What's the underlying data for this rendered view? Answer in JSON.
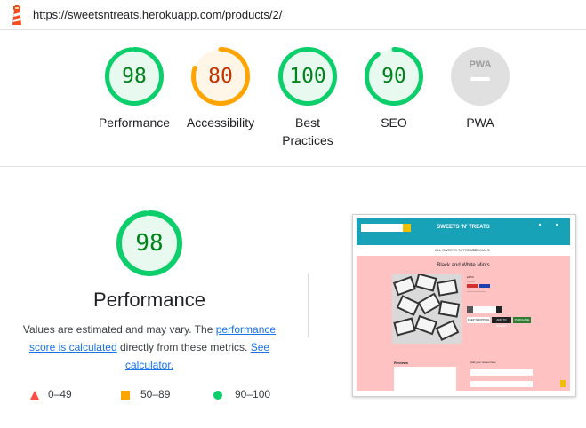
{
  "url": "https://sweetsntreats.herokuapp.com/products/2/",
  "categories": [
    {
      "label": "Performance",
      "score": 98,
      "score_text": "98",
      "color": "#0cce6b",
      "bg": "#e8f9ef",
      "text_color": "#00831b"
    },
    {
      "label": "Accessibility",
      "score": 80,
      "score_text": "80",
      "color": "#ffa400",
      "bg": "#fff6e8",
      "text_color": "#c33300"
    },
    {
      "label": "Best Practices",
      "score": 100,
      "score_text": "100",
      "color": "#0cce6b",
      "bg": "#e8f9ef",
      "text_color": "#00831b"
    },
    {
      "label": "SEO",
      "score": 90,
      "score_text": "90",
      "color": "#0cce6b",
      "bg": "#e8f9ef",
      "text_color": "#00831b"
    },
    {
      "label": "PWA",
      "score_text": "PWA",
      "color": "#e0e0e0",
      "bg": "#e0e0e0",
      "text_color": "#9e9e9e"
    }
  ],
  "performance": {
    "score": 98,
    "score_text": "98",
    "title": "Performance",
    "desc_start": "Values are estimated and may vary. The ",
    "link1": "performance score is calculated",
    "desc_mid": " directly from these metrics. ",
    "link2": "See calculator."
  },
  "legend": [
    {
      "icon": "red-triangle-icon",
      "range": "0–49",
      "color": "#ff4e42"
    },
    {
      "icon": "orange-square-icon",
      "range": "50–89",
      "color": "#ffa400"
    },
    {
      "icon": "green-circle-icon",
      "range": "90–100",
      "color": "#0cce6b"
    }
  ],
  "screenshot": {
    "brand": "SWEETS 'N' TREATS",
    "nav": [
      "ALL SWEETS 'N' TREATS",
      "SPECIALS"
    ],
    "product_title": "Black and White Mints",
    "price": "£2.50",
    "buttons": [
      "KEEP SHOPPING",
      "ADD TO BASKET",
      "PURCHASE"
    ],
    "reviews_heading": "Reviews",
    "form_heading": "Add your review here:",
    "colors": {
      "header": "#17a2b8",
      "page": "#ffc2c2",
      "accent": "#f0c000"
    }
  }
}
